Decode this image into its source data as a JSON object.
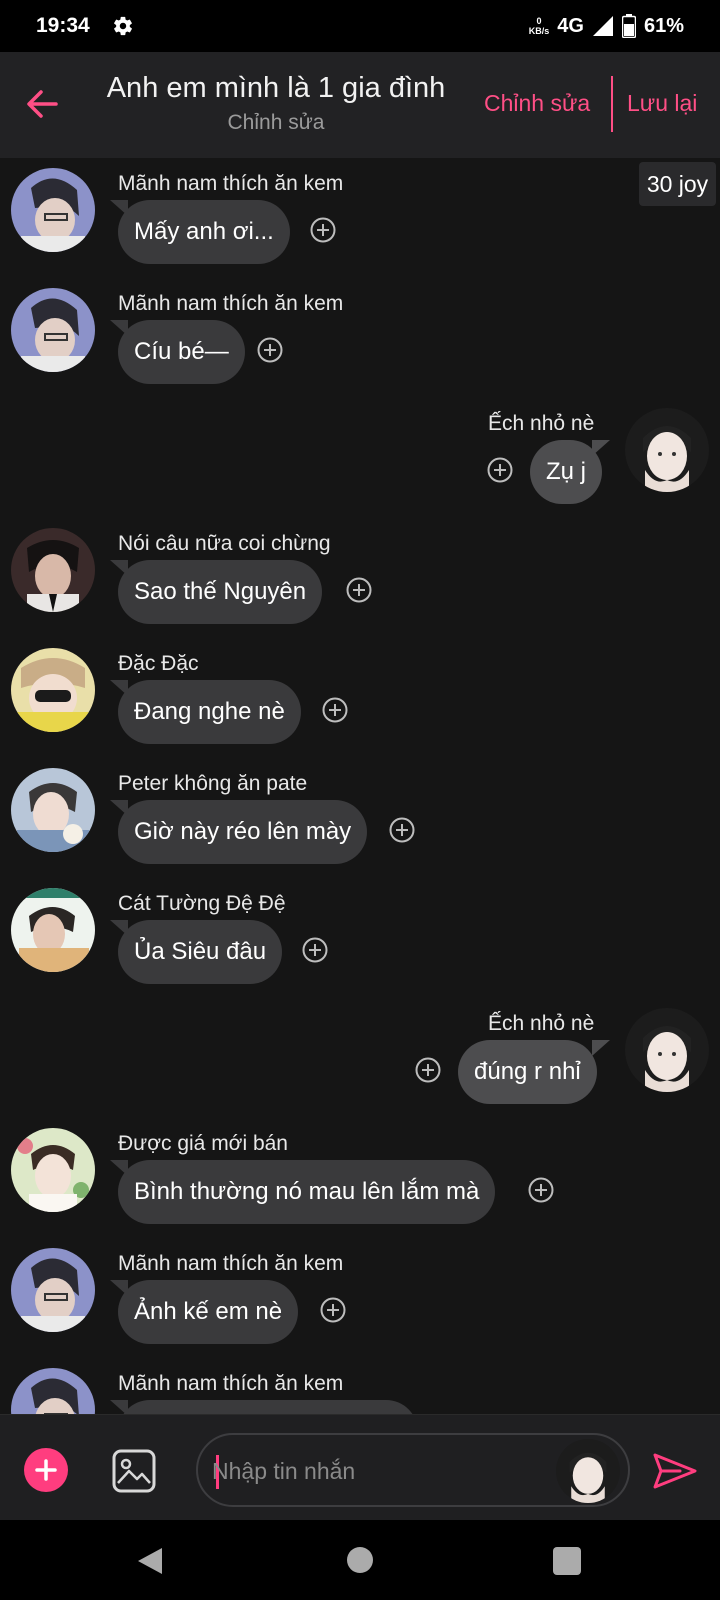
{
  "status_bar": {
    "time": "19:34",
    "net_speed": "0",
    "net_unit": "KB/s",
    "network": "4G",
    "battery": "61%"
  },
  "header": {
    "title": "Anh em mình là 1 gia đình",
    "subtitle": "Chỉnh sửa",
    "edit_label": "Chỉnh sửa",
    "save_label": "Lưu lại"
  },
  "joy_badge": "30 joy",
  "messages": [
    {
      "sender": "Mãnh nam thích ăn kem",
      "text": "Mấy anh ơi...",
      "side": "left"
    },
    {
      "sender": "Mãnh nam thích ăn kem",
      "text": "Cíu bé—",
      "side": "left"
    },
    {
      "sender": "Ếch nhỏ nè",
      "text": "Zụ j",
      "side": "right"
    },
    {
      "sender": "Nói câu nữa coi chừng",
      "text": "Sao thế Nguyên",
      "side": "left"
    },
    {
      "sender": "Đặc Đặc",
      "text": "Đang nghe nè",
      "side": "left"
    },
    {
      "sender": "Peter không ăn pate",
      "text": "Giờ này réo lên mày",
      "side": "left"
    },
    {
      "sender": "Cát Tường Đệ Đệ",
      "text": "Ủa Siêu đâu",
      "side": "left"
    },
    {
      "sender": "Ếch nhỏ nè",
      "text": "đúng r nhỉ",
      "side": "right"
    },
    {
      "sender": "Được giá mới bán",
      "text": "Bình thường nó mau lên lắm mà",
      "side": "left"
    },
    {
      "sender": "Mãnh nam thích ăn kem",
      "text": "Ảnh kế em nè",
      "side": "left"
    },
    {
      "sender": "Mãnh nam thích ăn kem",
      "text": "",
      "side": "left"
    }
  ],
  "input": {
    "placeholder": "Nhập tin nhắn"
  },
  "colors": {
    "accent": "#ff4f86",
    "background": "#151515",
    "appbar": "#222224",
    "bubble_left": "#3a3a3c",
    "bubble_right": "#4d4d4f"
  },
  "icons": {
    "back": "arrow-left-icon",
    "settings": "gear-icon",
    "add": "plus-icon",
    "image": "image-icon",
    "send": "send-icon",
    "react": "plus-circle-icon"
  }
}
